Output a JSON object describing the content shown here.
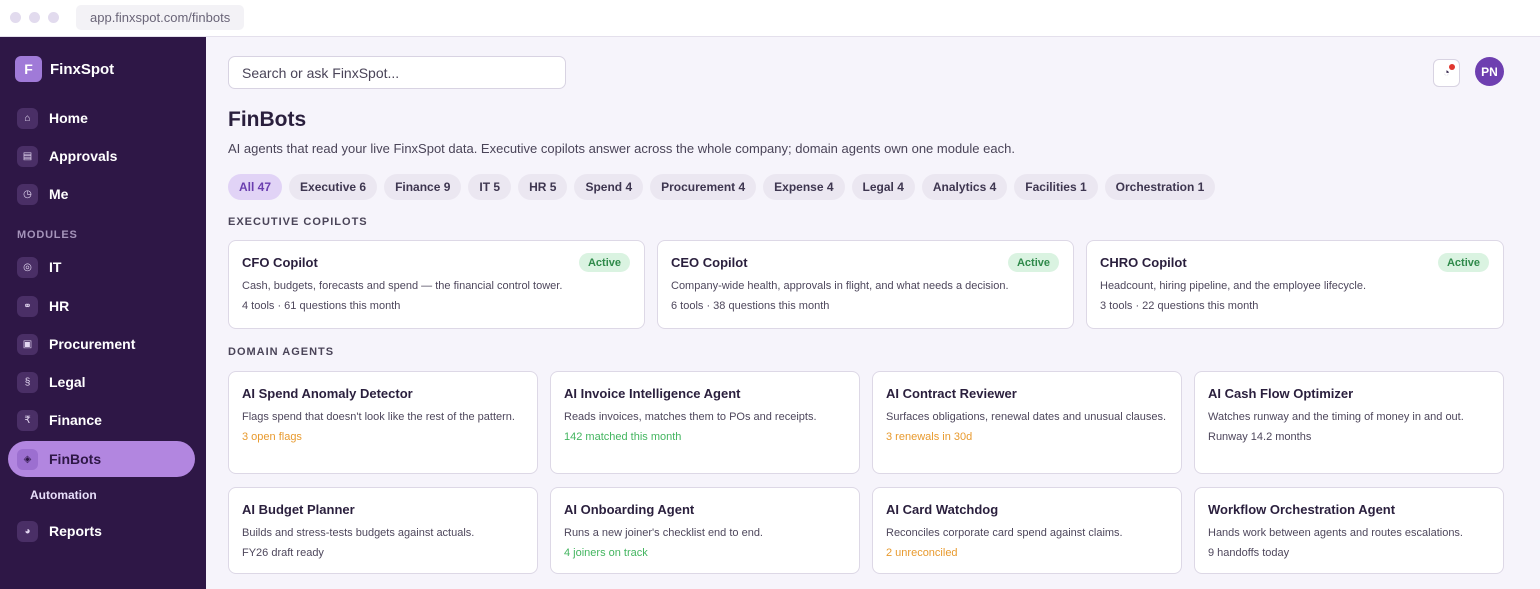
{
  "browser": {
    "url": "app.finxspot.com/finbots"
  },
  "sidebar": {
    "brand_initial": "F",
    "brand_name": "FinxSpot",
    "items": [
      {
        "label": "Home",
        "icon": "home-icon",
        "glyph": "⌂"
      },
      {
        "label": "Approvals",
        "icon": "list-icon",
        "glyph": "▤"
      },
      {
        "label": "Me",
        "icon": "clock-icon",
        "glyph": "◷"
      }
    ],
    "section_label": "MODULES",
    "modules": [
      {
        "label": "IT",
        "icon": "target-icon",
        "glyph": "◎"
      },
      {
        "label": "HR",
        "icon": "people-icon",
        "glyph": "⚭"
      },
      {
        "label": "Procurement",
        "icon": "box-icon",
        "glyph": "▣"
      },
      {
        "label": "Legal",
        "icon": "section-icon",
        "glyph": "§"
      },
      {
        "label": "Finance",
        "icon": "rupee-icon",
        "glyph": "₹"
      },
      {
        "label": "FinBots",
        "icon": "bot-icon",
        "glyph": "◈",
        "active": true
      }
    ],
    "sub_item": "Automation",
    "reports": {
      "label": "Reports",
      "icon": "pie-icon",
      "glyph": "◕"
    }
  },
  "header": {
    "search_placeholder": "Search or ask FinxSpot...",
    "avatar_initials": "PN",
    "notification_glyph": "◔"
  },
  "page": {
    "title": "FinBots",
    "subtitle": "AI agents that read your live FinxSpot data. Executive copilots answer across the whole company; domain agents own one module each."
  },
  "tabs": [
    "All 47",
    "Executive 6",
    "Finance 9",
    "IT 5",
    "HR 5",
    "Spend 4",
    "Procurement 4",
    "Expense 4",
    "Legal 4",
    "Analytics 4",
    "Facilities 1",
    "Orchestration 1"
  ],
  "executive": {
    "title": "EXECUTIVE COPILOTS",
    "cards": [
      {
        "title": "CFO Copilot",
        "badge": "Active",
        "desc": "Cash, budgets, forecasts and spend — the financial control tower.",
        "meta": "4 tools · 61 questions this month"
      },
      {
        "title": "CEO Copilot",
        "badge": "Active",
        "desc": "Company-wide health, approvals in flight, and what needs a decision.",
        "meta": "6 tools · 38 questions this month"
      },
      {
        "title": "CHRO Copilot",
        "badge": "Active",
        "desc": "Headcount, hiring pipeline, and the employee lifecycle.",
        "meta": "3 tools · 22 questions this month"
      }
    ]
  },
  "domain": {
    "title": "DOMAIN AGENTS",
    "cards": [
      {
        "title": "AI Spend Anomaly Detector",
        "desc": "Flags spend that doesn't look like the rest of the pattern.",
        "meta": "3 open flags",
        "tone": "orange"
      },
      {
        "title": "AI Invoice Intelligence Agent",
        "desc": "Reads invoices, matches them to POs and receipts.",
        "meta": "142 matched this month",
        "tone": "green"
      },
      {
        "title": "AI Contract Reviewer",
        "desc": "Surfaces obligations, renewal dates and unusual clauses.",
        "meta": "3 renewals in 30d",
        "tone": "orange"
      },
      {
        "title": "AI Cash Flow Optimizer",
        "desc": "Watches runway and the timing of money in and out.",
        "meta": "Runway 14.2 months",
        "tone": "gray"
      },
      {
        "title": "AI Budget Planner",
        "desc": "Builds and stress-tests budgets against actuals.",
        "meta": "FY26 draft ready",
        "tone": "gray"
      },
      {
        "title": "AI Onboarding Agent",
        "desc": "Runs a new joiner's checklist end to end.",
        "meta": "4 joiners on track",
        "tone": "green"
      },
      {
        "title": "AI Card Watchdog",
        "desc": "Reconciles corporate card spend against claims.",
        "meta": "2 unreconciled",
        "tone": "orange"
      },
      {
        "title": "Workflow Orchestration Agent",
        "desc": "Hands work between agents and routes escalations.",
        "meta": "9 handoffs today",
        "tone": "gray"
      }
    ]
  },
  "colors": {
    "sidebar_bg": "#2e1746",
    "accent": "#b286e0",
    "active_badge": "#2f8a4a",
    "warn": "#e89a2e",
    "ok": "#43b55f"
  }
}
